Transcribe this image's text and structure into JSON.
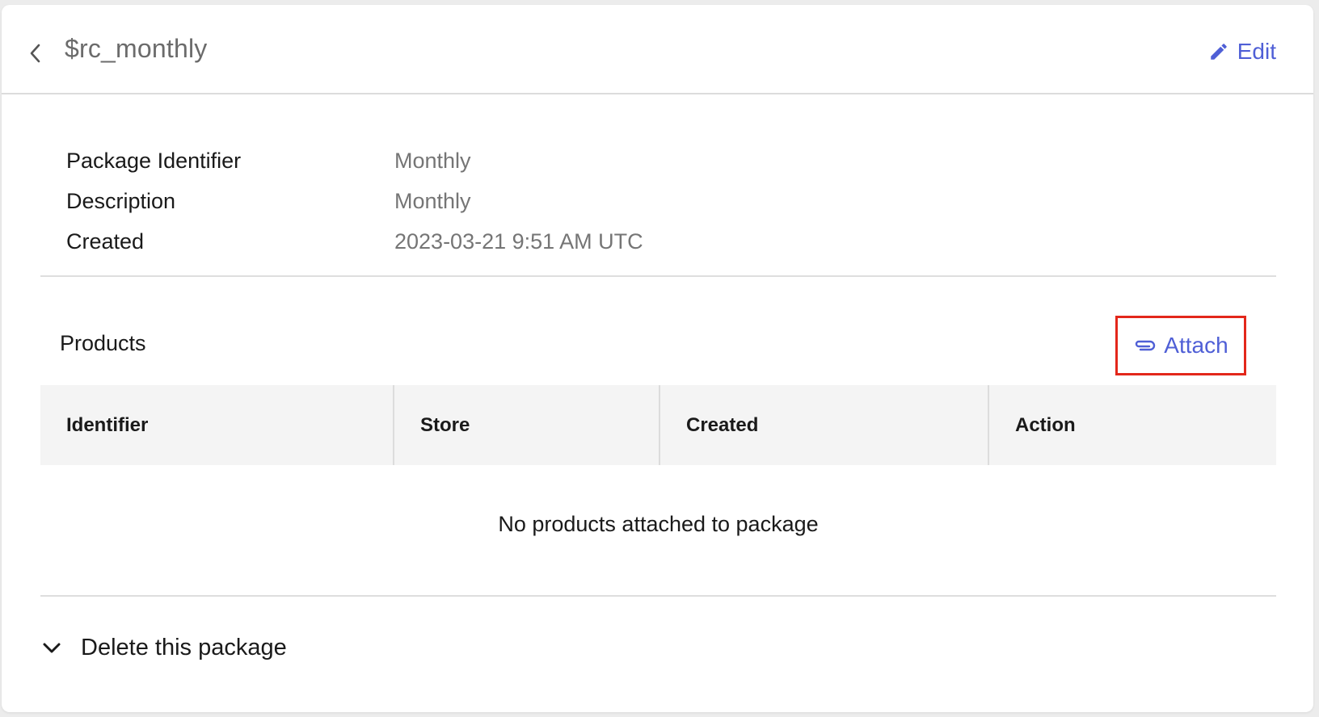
{
  "header": {
    "title": "$rc_monthly",
    "back_icon": "chevron-left-icon",
    "edit_label": "Edit",
    "edit_icon": "pencil-icon"
  },
  "details": [
    {
      "label": "Package Identifier",
      "value": "Monthly"
    },
    {
      "label": "Description",
      "value": "Monthly"
    },
    {
      "label": "Created",
      "value": "2023-03-21 9:51 AM UTC"
    }
  ],
  "products": {
    "title": "Products",
    "attach_label": "Attach",
    "attach_icon": "paperclip-icon",
    "columns": [
      "Identifier",
      "Store",
      "Created",
      "Action"
    ],
    "empty_message": "No products attached to package"
  },
  "danger_zone": {
    "label": "Delete this package",
    "icon": "chevron-down-icon"
  },
  "colors": {
    "accent": "#4f5fd6",
    "highlight": "#e3271b"
  }
}
